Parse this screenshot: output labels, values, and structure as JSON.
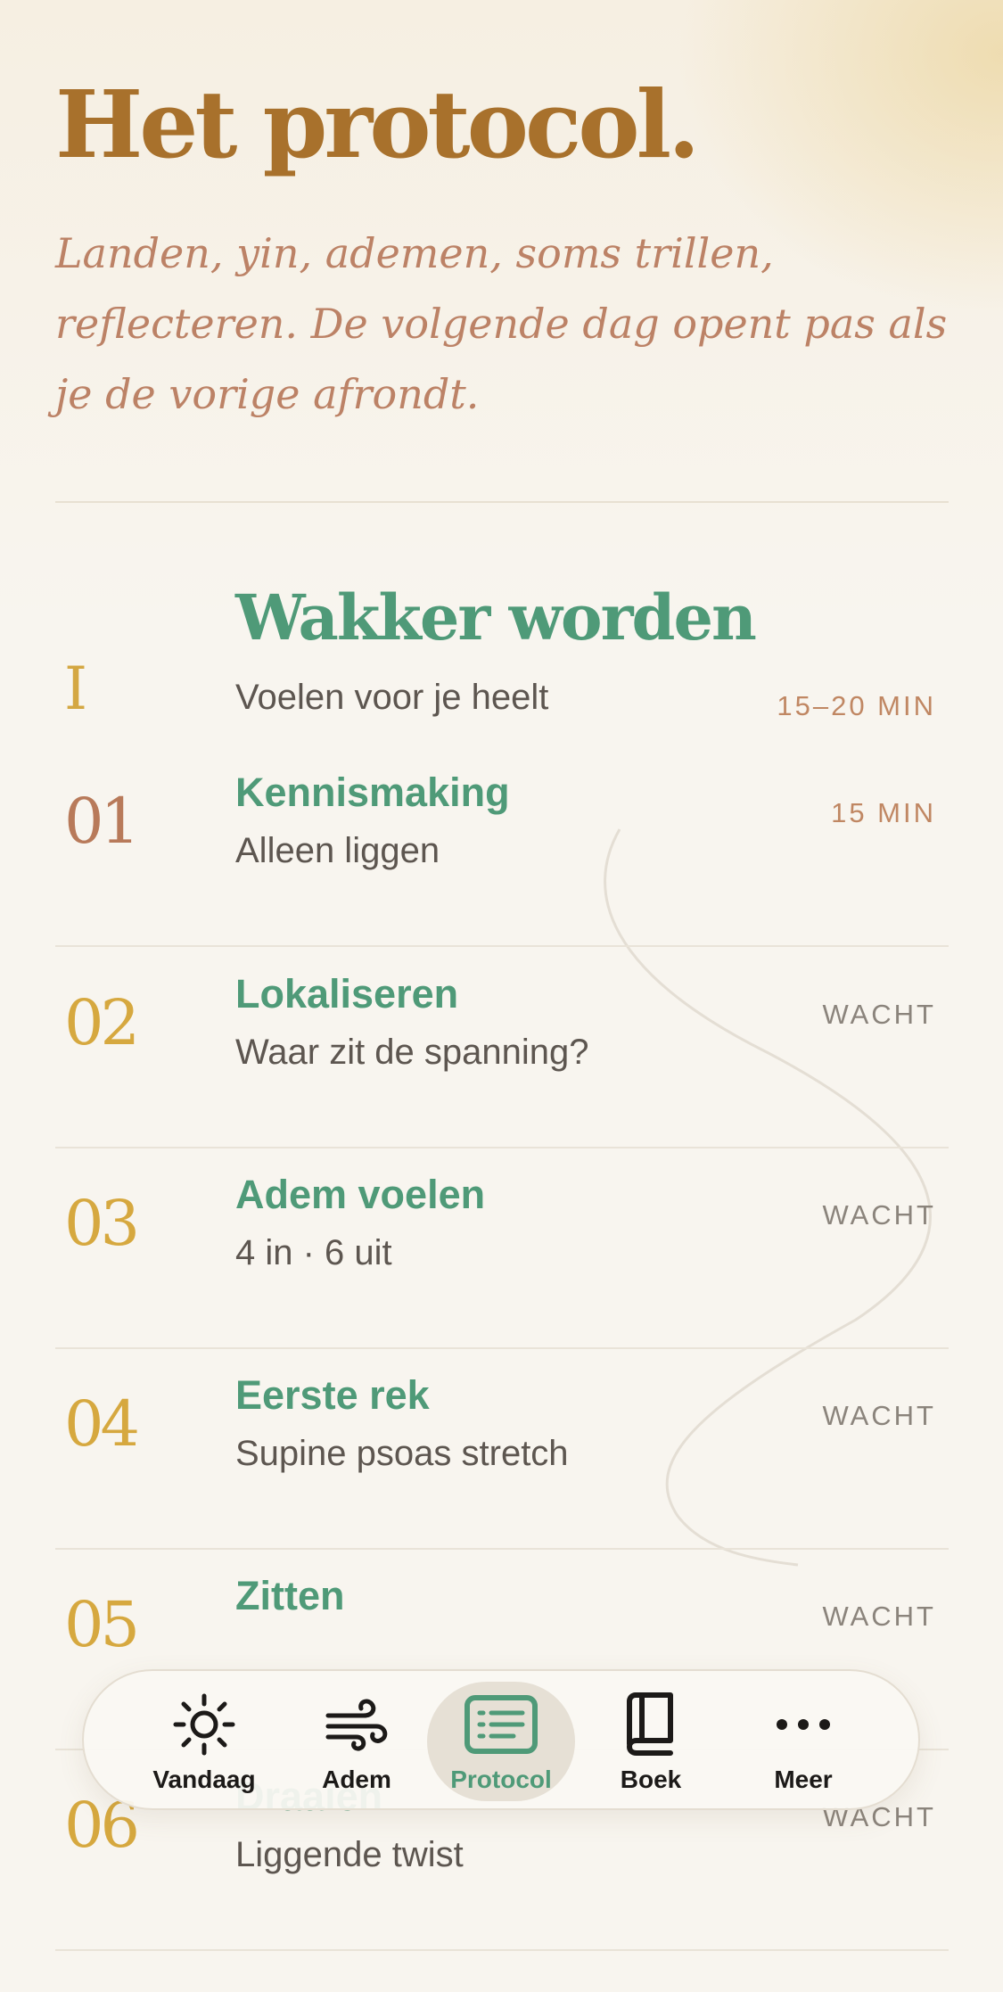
{
  "header": {
    "title": "Het protocol.",
    "intro": "Landen, yin, ademen, soms trillen, reflecteren. De volgende dag opent pas als je de vorige afrondt."
  },
  "lesson": {
    "numeral": "I",
    "title": "Wakker worden",
    "subtitle": "Voelen voor je heelt",
    "duration": "15–20 MIN"
  },
  "steps": [
    {
      "number": "01",
      "title": "Kennismaking",
      "subtitle": "Alleen liggen",
      "status": "15 MIN"
    },
    {
      "number": "02",
      "title": "Lokaliseren",
      "subtitle": "Waar zit de spanning?",
      "status": "WACHT"
    },
    {
      "number": "03",
      "title": "Adem voelen",
      "subtitle": "4 in · 6 uit",
      "status": "WACHT"
    },
    {
      "number": "04",
      "title": "Eerste rek",
      "subtitle": "Supine psoas stretch",
      "status": "WACHT"
    },
    {
      "number": "05",
      "title": "Zitten",
      "subtitle": "",
      "status": "WACHT"
    },
    {
      "number": "06",
      "title": "Draaien",
      "subtitle": "Liggende twist",
      "status": "WACHT"
    }
  ],
  "tabbar": {
    "items": [
      {
        "label": "Vandaag",
        "icon": "sun-icon"
      },
      {
        "label": "Adem",
        "icon": "wind-icon"
      },
      {
        "label": "Protocol",
        "icon": "document-icon",
        "active": true
      },
      {
        "label": "Boek",
        "icon": "book-icon"
      },
      {
        "label": "Meer",
        "icon": "more-icon"
      }
    ]
  },
  "colors": {
    "title_gold": "#a8712c",
    "intro_rose": "#bc8266",
    "accent_green": "#4f9a78",
    "numeral_gold": "#d6a83f",
    "active_numeral": "#b87a5a",
    "status_grey": "#8b847c",
    "background": "#f8f5ef"
  }
}
